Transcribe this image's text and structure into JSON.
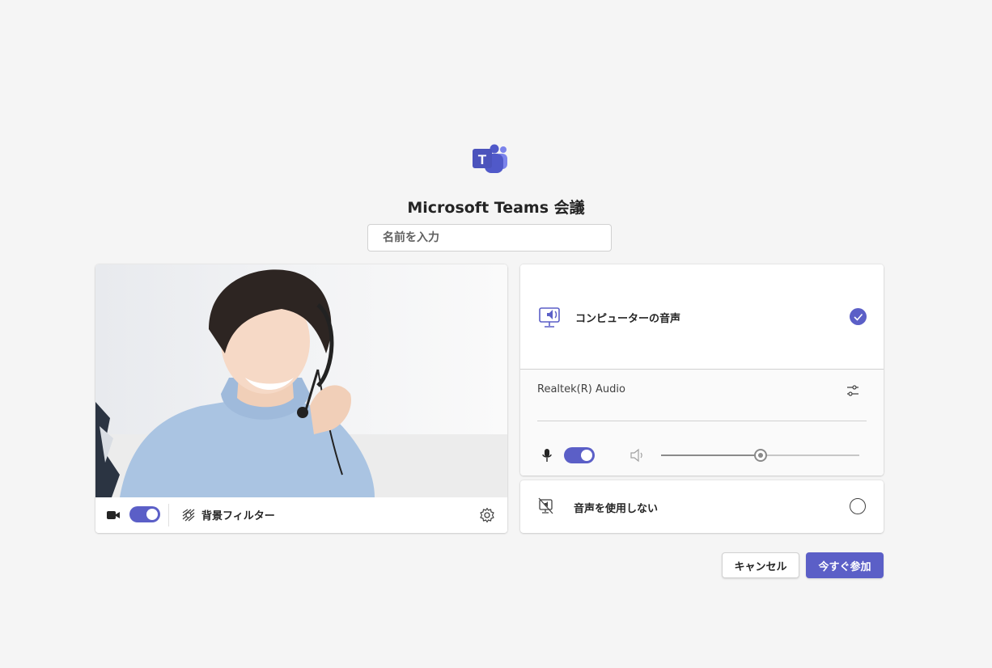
{
  "meeting": {
    "title": "Microsoft Teams 会議",
    "name_placeholder": "名前を入力",
    "name_value": ""
  },
  "video": {
    "camera_on": true,
    "background_filter_label": "背景フィルター"
  },
  "audio": {
    "options": [
      {
        "label": "コンピューターの音声",
        "selected": true
      },
      {
        "label": "音声を使用しない",
        "selected": false
      }
    ],
    "device_name": "Realtek(R) Audio",
    "mic_on": true,
    "speaker_volume": 0.5
  },
  "actions": {
    "cancel_label": "キャンセル",
    "join_label": "今すぐ参加"
  },
  "colors": {
    "accent": "#5b5fc7",
    "background": "#f5f5f5"
  },
  "icons": [
    "teams-logo-icon",
    "camera-icon",
    "background-filter-icon",
    "settings-gear-icon",
    "computer-audio-icon",
    "check-icon",
    "device-settings-icon",
    "microphone-icon",
    "speaker-icon",
    "no-audio-icon"
  ]
}
